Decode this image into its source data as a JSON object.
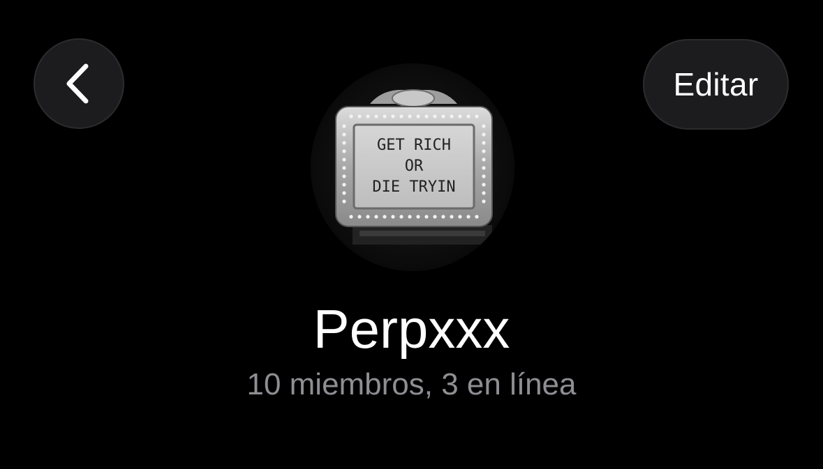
{
  "header": {
    "back_icon": "chevron-left-icon",
    "edit_label": "Editar"
  },
  "group": {
    "name": "Perpxxx",
    "status": "10 miembros, 3 en línea",
    "avatar": {
      "description_icon": "theater-marquee-sign",
      "sign_lines": [
        "GET RICH",
        "OR",
        "DIE TRYIN"
      ]
    }
  },
  "colors": {
    "background": "#000000",
    "button_bg": "#1c1c1e",
    "button_border": "#2c2c2e",
    "text_primary": "#ffffff",
    "text_secondary": "#8e8e93"
  }
}
